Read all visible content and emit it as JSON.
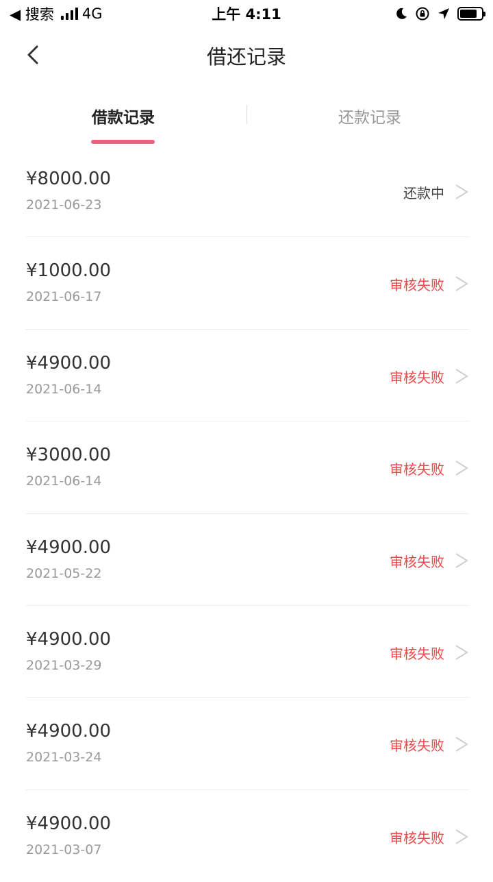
{
  "status_bar": {
    "back_label": "◀ 搜索",
    "network": "4G",
    "time": "上午 4:11",
    "battery_level": 0.8
  },
  "nav": {
    "title": "借还记录"
  },
  "tabs": [
    {
      "label": "借款记录",
      "active": true
    },
    {
      "label": "还款记录",
      "active": false
    }
  ],
  "records": [
    {
      "amount": "¥8000.00",
      "date": "2021-06-23",
      "status": "还款中",
      "status_type": "ok"
    },
    {
      "amount": "¥1000.00",
      "date": "2021-06-17",
      "status": "审核失败",
      "status_type": "fail"
    },
    {
      "amount": "¥4900.00",
      "date": "2021-06-14",
      "status": "审核失败",
      "status_type": "fail"
    },
    {
      "amount": "¥3000.00",
      "date": "2021-06-14",
      "status": "审核失败",
      "status_type": "fail"
    },
    {
      "amount": "¥4900.00",
      "date": "2021-05-22",
      "status": "审核失败",
      "status_type": "fail"
    },
    {
      "amount": "¥4900.00",
      "date": "2021-03-29",
      "status": "审核失败",
      "status_type": "fail"
    },
    {
      "amount": "¥4900.00",
      "date": "2021-03-24",
      "status": "审核失败",
      "status_type": "fail"
    },
    {
      "amount": "¥4900.00",
      "date": "2021-03-07",
      "status": "审核失败",
      "status_type": "fail"
    }
  ],
  "colors": {
    "accent": "#e8647e",
    "fail": "#e84a4a",
    "secondary_text": "#999999"
  },
  "icons": {
    "back": "chevron-left-icon",
    "row_arrow": "chevron-right-icon",
    "status_icons": [
      "signal-icon",
      "moon-icon",
      "orientation-lock-icon",
      "location-arrow-icon",
      "battery-icon"
    ]
  }
}
